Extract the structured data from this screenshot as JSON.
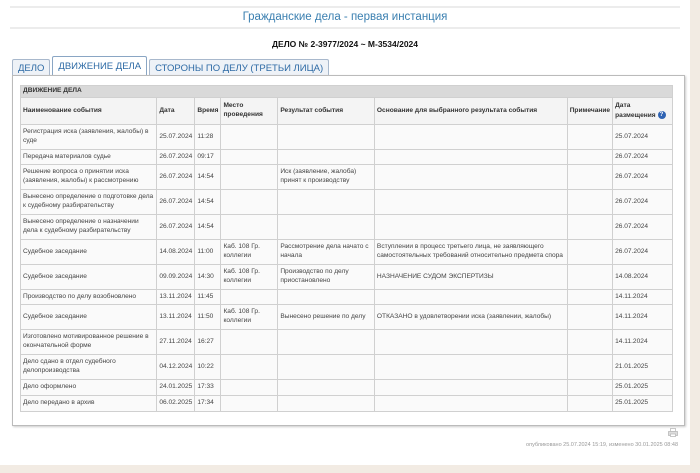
{
  "header": {
    "title": "Гражданские дела - первая инстанция",
    "case_number": "ДЕЛО № 2-3977/2024 ~ М-3534/2024"
  },
  "tabs": [
    {
      "label": "ДЕЛО"
    },
    {
      "label": "ДВИЖЕНИЕ ДЕЛА",
      "active": true
    },
    {
      "label": "СТОРОНЫ ПО ДЕЛУ (ТРЕТЬИ ЛИЦА)"
    }
  ],
  "table": {
    "section_title": "ДВИЖЕНИЕ ДЕЛА",
    "columns": [
      "Наименование события",
      "Дата",
      "Время",
      "Место проведения",
      "Результат события",
      "Основание для выбранного результата события",
      "Примечание",
      "Дата размещения"
    ],
    "help_icon": "?",
    "rows": [
      {
        "event": "Регистрация иска (заявления, жалобы) в суде",
        "date": "25.07.2024",
        "time": "11:28",
        "place": "",
        "result": "",
        "basis": "",
        "note": "",
        "posted": "25.07.2024"
      },
      {
        "event": "Передача материалов судье",
        "date": "26.07.2024",
        "time": "09:17",
        "place": "",
        "result": "",
        "basis": "",
        "note": "",
        "posted": "26.07.2024"
      },
      {
        "event": "Решение вопроса о принятии иска (заявления, жалобы) к рассмотрению",
        "date": "26.07.2024",
        "time": "14:54",
        "place": "",
        "result": "Иск (заявление, жалоба) принят к производству",
        "basis": "",
        "note": "",
        "posted": "26.07.2024"
      },
      {
        "event": "Вынесено определение о подготовке дела к судебному разбирательству",
        "date": "26.07.2024",
        "time": "14:54",
        "place": "",
        "result": "",
        "basis": "",
        "note": "",
        "posted": "26.07.2024"
      },
      {
        "event": "Вынесено определение о назначении дела к судебному разбирательству",
        "date": "26.07.2024",
        "time": "14:54",
        "place": "",
        "result": "",
        "basis": "",
        "note": "",
        "posted": "26.07.2024"
      },
      {
        "event": "Судебное заседание",
        "date": "14.08.2024",
        "time": "11:00",
        "place": "Каб. 108 Гр. коллегии",
        "result": "Рассмотрение дела начато с начала",
        "basis": "Вступлении в процесс третьего лица, не заявляющего самостоятельных требований относительно предмета спора",
        "note": "",
        "posted": "26.07.2024"
      },
      {
        "event": "Судебное заседание",
        "date": "09.09.2024",
        "time": "14:30",
        "place": "Каб. 108 Гр. коллегии",
        "result": "Производство по делу приостановлено",
        "basis": "НАЗНАЧЕНИЕ СУДОМ ЭКСПЕРТИЗЫ",
        "note": "",
        "posted": "14.08.2024"
      },
      {
        "event": "Производство по делу возобновлено",
        "date": "13.11.2024",
        "time": "11:45",
        "place": "",
        "result": "",
        "basis": "",
        "note": "",
        "posted": "14.11.2024"
      },
      {
        "event": "Судебное заседание",
        "date": "13.11.2024",
        "time": "11:50",
        "place": "Каб. 108 Гр. коллегии",
        "result": "Вынесено решение по делу",
        "basis": "ОТКАЗАНО в удовлетворении иска (заявлении, жалобы)",
        "note": "",
        "posted": "14.11.2024"
      },
      {
        "event": "Изготовлено мотивированное решение в окончательной форме",
        "date": "27.11.2024",
        "time": "16:27",
        "place": "",
        "result": "",
        "basis": "",
        "note": "",
        "posted": "14.11.2024"
      },
      {
        "event": "Дело сдано в отдел судебного делопроизводства",
        "date": "04.12.2024",
        "time": "10:22",
        "place": "",
        "result": "",
        "basis": "",
        "note": "",
        "posted": "21.01.2025"
      },
      {
        "event": "Дело оформлено",
        "date": "24.01.2025",
        "time": "17:33",
        "place": "",
        "result": "",
        "basis": "",
        "note": "",
        "posted": "25.01.2025"
      },
      {
        "event": "Дело передано в архив",
        "date": "06.02.2025",
        "time": "17:34",
        "place": "",
        "result": "",
        "basis": "",
        "note": "",
        "posted": "25.01.2025"
      }
    ]
  },
  "footer": {
    "published": "опубликовано 25.07.2024 15:19, изменено 30.01.2025 08:48"
  }
}
